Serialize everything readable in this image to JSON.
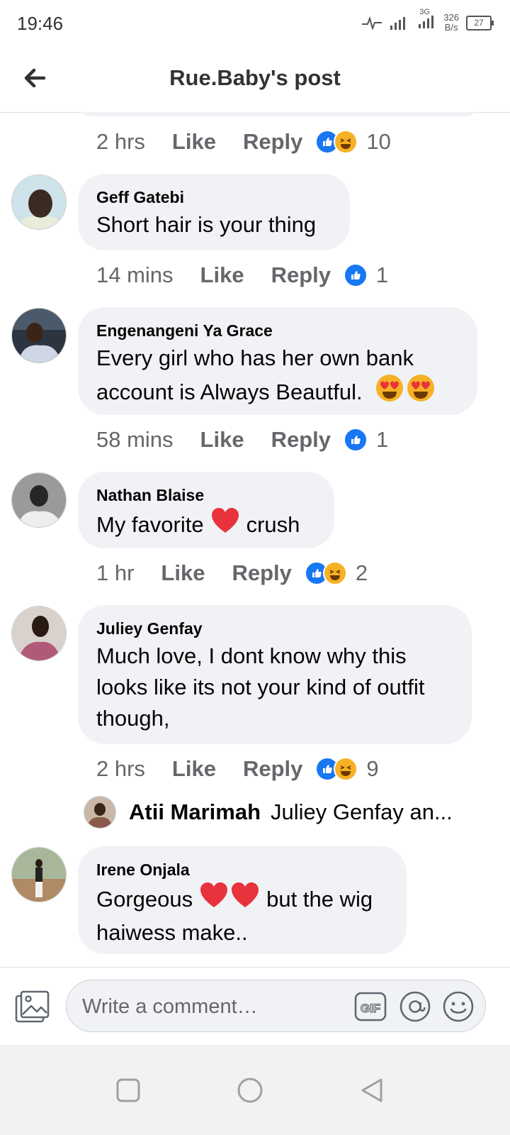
{
  "status_bar": {
    "time": "19:46",
    "network": "3G",
    "speed_value": "326",
    "speed_unit": "B/s",
    "battery": "27"
  },
  "header": {
    "title": "Rue.Baby's post",
    "back_icon": "arrow-left-icon"
  },
  "first_actions": {
    "time": "2 hrs",
    "like": "Like",
    "reply": "Reply",
    "count": "10"
  },
  "comments": [
    {
      "author": "Geff Gatebi",
      "text": "Short hair is your thing",
      "time": "14 mins",
      "like": "Like",
      "reply": "Reply",
      "count": "1"
    },
    {
      "author": "Engenangeni Ya Grace",
      "text_line1": "Every girl who has her own bank",
      "text_line2": "account is Always Beautful.",
      "time": "58 mins",
      "like": "Like",
      "reply": "Reply",
      "count": "1"
    },
    {
      "author": "Nathan Blaise",
      "text_before": "My favorite",
      "text_after": "crush",
      "time": "1 hr",
      "like": "Like",
      "reply": "Reply",
      "count": "2"
    },
    {
      "author": "Juliey Genfay",
      "text_line1": "Much love, I dont know why this",
      "text_line2": "looks like its not your kind of outfit",
      "text_line3": "though,",
      "time": "2 hrs",
      "like": "Like",
      "reply": "Reply",
      "count": "9"
    },
    {
      "author": "Irene Onjala",
      "text_before": "Gorgeous",
      "text_after": "but the wig",
      "text_line2": "haiwess make.."
    }
  ],
  "reply_preview": {
    "name": "Atii Marimah",
    "text": "Juliey Genfay an..."
  },
  "composer": {
    "placeholder": "Write a comment…",
    "gif_label": "GIF"
  },
  "colors": {
    "bubble": "#f0f2f5",
    "like_blue": "#1877f2",
    "secondary_text": "#65676b",
    "heart_red": "#e8323c",
    "emoji_yellow": "#f7b125"
  }
}
